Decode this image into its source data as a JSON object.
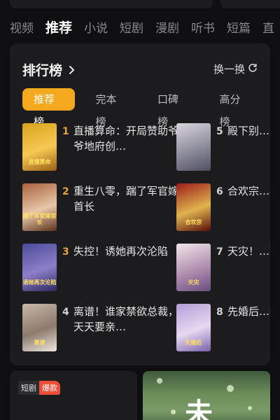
{
  "category_tabs": [
    "视频",
    "推荐",
    "小说",
    "短剧",
    "漫剧",
    "听书",
    "短篇",
    "直"
  ],
  "category_active_index": 1,
  "ranking": {
    "title": "排行榜",
    "refresh_label": "换一换",
    "sub_tabs": [
      "推荐榜",
      "完本榜",
      "口碑榜",
      "高分榜"
    ],
    "active_sub_tab": 0,
    "books": [
      {
        "rank": "1",
        "title": "直播算命：开局赞助爷爷地府创…",
        "cover_text": "直播算命",
        "cover_colors": [
          "#d8a21c",
          "#f6c955",
          "#9a5f12"
        ],
        "rank_color": "#e6a23c"
      },
      {
        "rank": "2",
        "title": "重生八零，踹了军官嫁首长",
        "cover_text": "踹了军官嫁首长",
        "cover_colors": [
          "#a8623e",
          "#e8c8a8",
          "#5a2f1a"
        ],
        "rank_color": "#e6a23c"
      },
      {
        "rank": "3",
        "title": "失控！诱她再次沦陷",
        "cover_text": "诱她再次沦陷",
        "cover_colors": [
          "#4a4b9a",
          "#8d7fc9",
          "#2a2a60"
        ],
        "rank_color": "#e6a23c"
      },
      {
        "rank": "4",
        "title": "离谱！谁家禁欲总裁，天天要亲…",
        "cover_text": "离谱",
        "cover_colors": [
          "#c9b9a7",
          "#8c7a6e",
          "#efe7df"
        ],
        "rank_color": "#d0d0d0"
      },
      {
        "rank": "5",
        "title": "殿下别…的佛珠…",
        "cover_text": "",
        "cover_colors": [
          "#d9d4dc",
          "#8e8d9c",
          "#4f4e62"
        ],
        "rank_color": "#d0d0d0"
      },
      {
        "rank": "6",
        "title": "合欢宗…小白花…",
        "cover_text": "合欢宗",
        "cover_colors": [
          "#9c1c1a",
          "#e0b34e",
          "#5a0d0c"
        ],
        "rank_color": "#d0d0d0"
      },
      {
        "rank": "7",
        "title": "天灾！…下粮仓…",
        "cover_text": "天灾",
        "cover_colors": [
          "#f2e6e8",
          "#b08fb0",
          "#6a4e7e"
        ],
        "rank_color": "#d0d0d0"
      },
      {
        "rank": "8",
        "title": "先婚后…老公野…",
        "cover_text": "先婚后",
        "cover_colors": [
          "#b49ed6",
          "#e6d8f2",
          "#7a62a8"
        ],
        "rank_color": "#d0d0d0"
      }
    ]
  },
  "bottom": {
    "badge_category": "短剧",
    "badge_hot": "爆款",
    "poster_char": "未"
  },
  "colors": {
    "accent": "#f3a81d",
    "card_bg": "#1c1c1f",
    "page_bg": "#0f0f11",
    "hot_red": "#ee4d3a"
  }
}
